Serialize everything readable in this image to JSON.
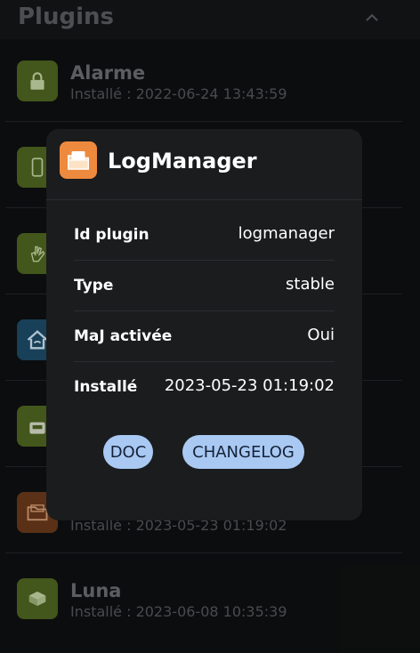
{
  "header": {
    "title": "Plugins",
    "collapse_icon": "chevron-up-icon"
  },
  "plugins": [
    {
      "name": "Alarme",
      "installed": "Installé : 2022-06-24 13:43:59",
      "icon": "lock-icon"
    },
    {
      "name": "",
      "installed": "",
      "icon": "phone-icon"
    },
    {
      "name": "",
      "installed": "",
      "icon": "hand-icon"
    },
    {
      "name": "",
      "installed": "",
      "icon": "home-wifi-icon"
    },
    {
      "name": "",
      "installed": "",
      "icon": "device-icon"
    },
    {
      "name": "",
      "installed": "Installé : 2023-05-23 01:19:02",
      "icon": "folder-icon"
    },
    {
      "name": "Luna",
      "installed": "Installé : 2023-06-08 10:35:39",
      "icon": "luna-box-icon"
    }
  ],
  "modal": {
    "title": "LogManager",
    "icon": "folder-icon",
    "details": [
      {
        "label": "Id plugin",
        "value": "logmanager"
      },
      {
        "label": "Type",
        "value": "stable"
      },
      {
        "label": "MaJ activée",
        "value": "Oui"
      },
      {
        "label": "Installé",
        "value": "2023-05-23 01:19:02"
      }
    ],
    "buttons": {
      "doc": "DOC",
      "changelog": "CHANGELOG"
    }
  },
  "colors": {
    "accent_button": "#a9c9f3",
    "modal_icon": "#ee8a3e",
    "plugin_icon_green": "#4f6520"
  }
}
